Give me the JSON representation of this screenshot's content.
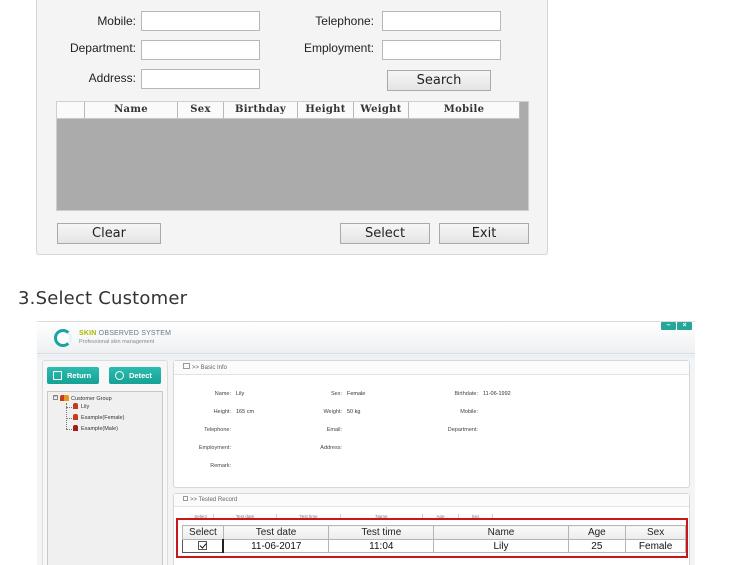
{
  "search_form": {
    "fields": [
      {
        "label": "Mobile:",
        "value": ""
      },
      {
        "label": "Department:",
        "value": ""
      },
      {
        "label": "Address:",
        "value": ""
      },
      {
        "label": "Telephone:",
        "value": ""
      },
      {
        "label": "Employment:",
        "value": ""
      }
    ],
    "search_button": "Search",
    "grid_columns": [
      "",
      "Name",
      "Sex",
      "Birthday",
      "Height",
      "Weight",
      "Mobile"
    ],
    "clear_button": "Clear",
    "select_button": "Select",
    "exit_button": "Exit"
  },
  "section_title": "3.Select Customer",
  "app": {
    "brand_highlight": "SKIN",
    "brand_rest": " OBSERVED SYSTEM",
    "tagline": "Professional skin management",
    "minimize_icon": "–",
    "close_icon": "×",
    "return_button": "Return",
    "detect_button": "Detect",
    "tree": {
      "root": "Customer Group",
      "expander": "−",
      "children": [
        "Lily",
        "Example(Female)",
        "Example(Male)"
      ]
    },
    "basic_info": {
      "title": ">> Basic Info",
      "fields": [
        {
          "label": "Name:",
          "value": "Lily"
        },
        {
          "label": "Sex:",
          "value": "Female"
        },
        {
          "label": "Birthdate:",
          "value": "11-06-1992"
        },
        {
          "label": "Height:",
          "value": "165 cm"
        },
        {
          "label": "Weight:",
          "value": "50 kg"
        },
        {
          "label": "Mobile:",
          "value": ""
        },
        {
          "label": "Telephone:",
          "value": ""
        },
        {
          "label": "Email:",
          "value": ""
        },
        {
          "label": "Department:",
          "value": ""
        },
        {
          "label": "Employment:",
          "value": ""
        },
        {
          "label": "Address:",
          "value": ""
        },
        {
          "label": "Remark:",
          "value": ""
        }
      ]
    },
    "tested_record": {
      "title": ">> Tested Record",
      "columns": [
        "Select",
        "Test date",
        "Test time",
        "Name",
        "Age",
        "Sex"
      ],
      "rows": [
        {
          "selected": true,
          "test_date": "11-06-2017",
          "test_time": "11:04",
          "name": "Lily",
          "age": "25",
          "sex": "Female"
        }
      ]
    }
  }
}
